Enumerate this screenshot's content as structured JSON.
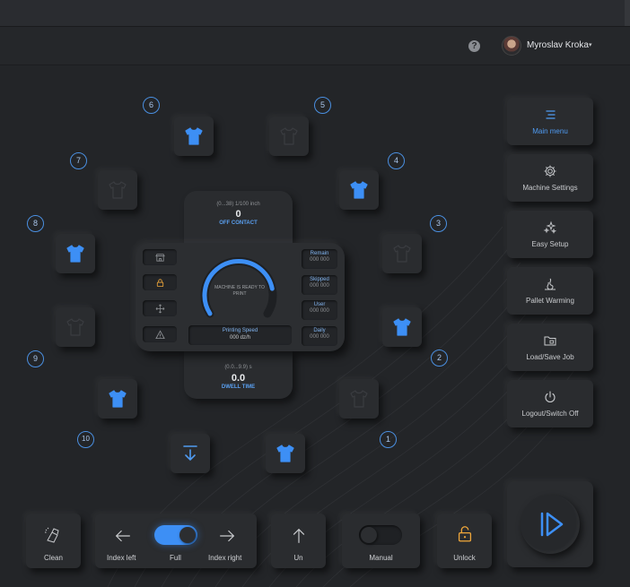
{
  "header": {
    "user_name": "Myroslav Kroka",
    "help_glyph": "?",
    "caret": "▾"
  },
  "slots": [
    {
      "n": "1",
      "printed": false
    },
    {
      "n": "2",
      "printed": true
    },
    {
      "n": "3",
      "printed": false
    },
    {
      "n": "4",
      "printed": true
    },
    {
      "n": "5",
      "printed": false
    },
    {
      "n": "6",
      "printed": true
    },
    {
      "n": "7",
      "printed": false
    },
    {
      "n": "8",
      "printed": true
    },
    {
      "n": "9",
      "printed": false
    },
    {
      "n": "10",
      "printed": true
    }
  ],
  "extra_shirt": {
    "printed": true
  },
  "off_contact": {
    "range": "(0...38) 1/100 inch",
    "value": "0",
    "label": "OFF CONTACT"
  },
  "dwell": {
    "range": "(0.0...9.9) s",
    "value": "0.0",
    "label": "DWELL TIME"
  },
  "gauge": {
    "status": "MACHINE IS READY TO PRINT",
    "fill_fraction": 0.82
  },
  "stats": [
    {
      "label": "Remain",
      "value": "000 000"
    },
    {
      "label": "Skipped",
      "value": "000 000"
    },
    {
      "label": "User",
      "value": "000 000"
    },
    {
      "label": "Daily",
      "value": "000 000"
    }
  ],
  "speed": {
    "label": "Printing Speed",
    "value": "000 dz/h"
  },
  "left_icons": [
    "store-icon",
    "lock-icon",
    "move-icon",
    "warning-icon"
  ],
  "menu": [
    {
      "label": "Main menu",
      "icon": "menu-icon",
      "active": true
    },
    {
      "label": "Machine Settings",
      "icon": "gear-icon",
      "active": false
    },
    {
      "label": "Easy Setup",
      "icon": "sparkle-icon",
      "active": false
    },
    {
      "label": "Pallet Warming",
      "icon": "heat-icon",
      "active": false
    },
    {
      "label": "Load/Save Job",
      "icon": "folder-icon",
      "active": false
    },
    {
      "label": "Logout/Switch Off",
      "icon": "power-icon",
      "active": false
    }
  ],
  "bottom": {
    "clean": "Clean",
    "index_left": "Index left",
    "full": "Full",
    "index_right": "Index right",
    "up": "Un",
    "manual": "Manual",
    "unlock": "Unlock",
    "full_toggle_on": true,
    "manual_toggle_on": false
  },
  "colors": {
    "accent": "#4a8fe0",
    "shirt_printed": "#3d8ff5",
    "shirt_empty": "#3a3c40",
    "unlock": "#f0a73a",
    "bg": "#232528"
  }
}
